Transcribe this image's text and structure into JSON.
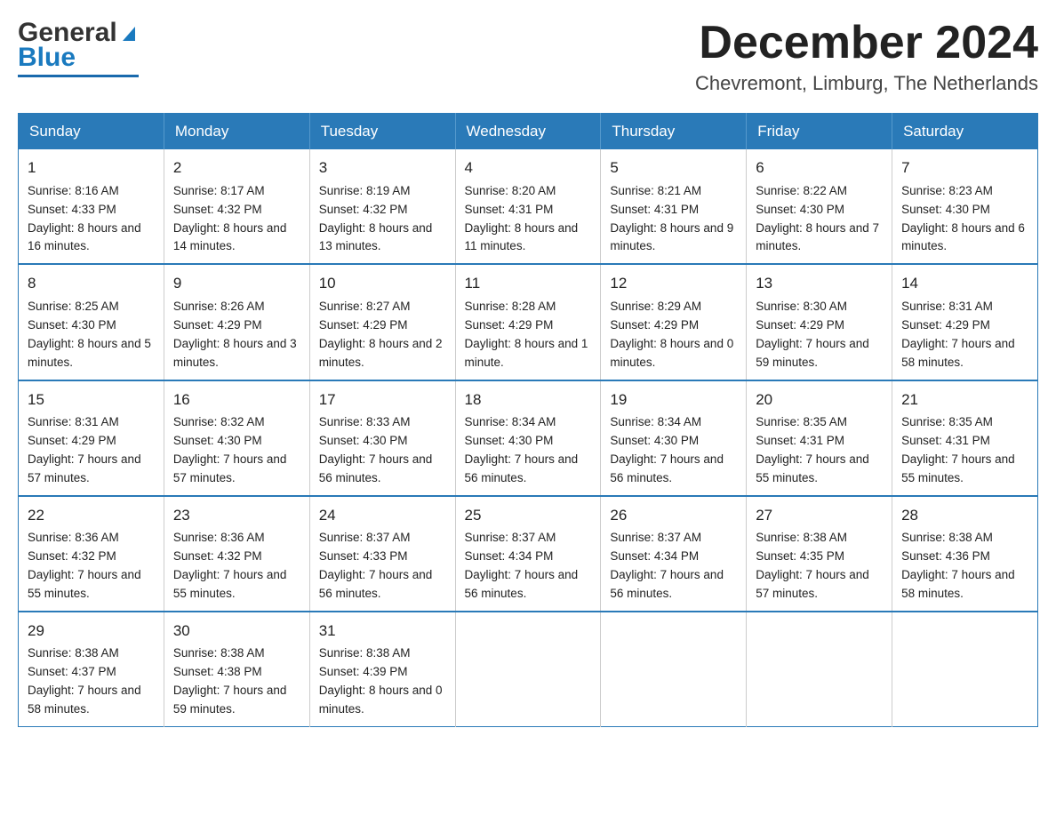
{
  "header": {
    "logo_general": "General",
    "logo_blue": "Blue",
    "month_title": "December 2024",
    "location": "Chevremont, Limburg, The Netherlands"
  },
  "calendar": {
    "days_of_week": [
      "Sunday",
      "Monday",
      "Tuesday",
      "Wednesday",
      "Thursday",
      "Friday",
      "Saturday"
    ],
    "weeks": [
      [
        {
          "day": "1",
          "sunrise": "8:16 AM",
          "sunset": "4:33 PM",
          "daylight": "8 hours and 16 minutes."
        },
        {
          "day": "2",
          "sunrise": "8:17 AM",
          "sunset": "4:32 PM",
          "daylight": "8 hours and 14 minutes."
        },
        {
          "day": "3",
          "sunrise": "8:19 AM",
          "sunset": "4:32 PM",
          "daylight": "8 hours and 13 minutes."
        },
        {
          "day": "4",
          "sunrise": "8:20 AM",
          "sunset": "4:31 PM",
          "daylight": "8 hours and 11 minutes."
        },
        {
          "day": "5",
          "sunrise": "8:21 AM",
          "sunset": "4:31 PM",
          "daylight": "8 hours and 9 minutes."
        },
        {
          "day": "6",
          "sunrise": "8:22 AM",
          "sunset": "4:30 PM",
          "daylight": "8 hours and 7 minutes."
        },
        {
          "day": "7",
          "sunrise": "8:23 AM",
          "sunset": "4:30 PM",
          "daylight": "8 hours and 6 minutes."
        }
      ],
      [
        {
          "day": "8",
          "sunrise": "8:25 AM",
          "sunset": "4:30 PM",
          "daylight": "8 hours and 5 minutes."
        },
        {
          "day": "9",
          "sunrise": "8:26 AM",
          "sunset": "4:29 PM",
          "daylight": "8 hours and 3 minutes."
        },
        {
          "day": "10",
          "sunrise": "8:27 AM",
          "sunset": "4:29 PM",
          "daylight": "8 hours and 2 minutes."
        },
        {
          "day": "11",
          "sunrise": "8:28 AM",
          "sunset": "4:29 PM",
          "daylight": "8 hours and 1 minute."
        },
        {
          "day": "12",
          "sunrise": "8:29 AM",
          "sunset": "4:29 PM",
          "daylight": "8 hours and 0 minutes."
        },
        {
          "day": "13",
          "sunrise": "8:30 AM",
          "sunset": "4:29 PM",
          "daylight": "7 hours and 59 minutes."
        },
        {
          "day": "14",
          "sunrise": "8:31 AM",
          "sunset": "4:29 PM",
          "daylight": "7 hours and 58 minutes."
        }
      ],
      [
        {
          "day": "15",
          "sunrise": "8:31 AM",
          "sunset": "4:29 PM",
          "daylight": "7 hours and 57 minutes."
        },
        {
          "day": "16",
          "sunrise": "8:32 AM",
          "sunset": "4:30 PM",
          "daylight": "7 hours and 57 minutes."
        },
        {
          "day": "17",
          "sunrise": "8:33 AM",
          "sunset": "4:30 PM",
          "daylight": "7 hours and 56 minutes."
        },
        {
          "day": "18",
          "sunrise": "8:34 AM",
          "sunset": "4:30 PM",
          "daylight": "7 hours and 56 minutes."
        },
        {
          "day": "19",
          "sunrise": "8:34 AM",
          "sunset": "4:30 PM",
          "daylight": "7 hours and 56 minutes."
        },
        {
          "day": "20",
          "sunrise": "8:35 AM",
          "sunset": "4:31 PM",
          "daylight": "7 hours and 55 minutes."
        },
        {
          "day": "21",
          "sunrise": "8:35 AM",
          "sunset": "4:31 PM",
          "daylight": "7 hours and 55 minutes."
        }
      ],
      [
        {
          "day": "22",
          "sunrise": "8:36 AM",
          "sunset": "4:32 PM",
          "daylight": "7 hours and 55 minutes."
        },
        {
          "day": "23",
          "sunrise": "8:36 AM",
          "sunset": "4:32 PM",
          "daylight": "7 hours and 55 minutes."
        },
        {
          "day": "24",
          "sunrise": "8:37 AM",
          "sunset": "4:33 PM",
          "daylight": "7 hours and 56 minutes."
        },
        {
          "day": "25",
          "sunrise": "8:37 AM",
          "sunset": "4:34 PM",
          "daylight": "7 hours and 56 minutes."
        },
        {
          "day": "26",
          "sunrise": "8:37 AM",
          "sunset": "4:34 PM",
          "daylight": "7 hours and 56 minutes."
        },
        {
          "day": "27",
          "sunrise": "8:38 AM",
          "sunset": "4:35 PM",
          "daylight": "7 hours and 57 minutes."
        },
        {
          "day": "28",
          "sunrise": "8:38 AM",
          "sunset": "4:36 PM",
          "daylight": "7 hours and 58 minutes."
        }
      ],
      [
        {
          "day": "29",
          "sunrise": "8:38 AM",
          "sunset": "4:37 PM",
          "daylight": "7 hours and 58 minutes."
        },
        {
          "day": "30",
          "sunrise": "8:38 AM",
          "sunset": "4:38 PM",
          "daylight": "7 hours and 59 minutes."
        },
        {
          "day": "31",
          "sunrise": "8:38 AM",
          "sunset": "4:39 PM",
          "daylight": "8 hours and 0 minutes."
        },
        null,
        null,
        null,
        null
      ]
    ],
    "sunrise_label": "Sunrise:",
    "sunset_label": "Sunset:",
    "daylight_label": "Daylight:"
  }
}
